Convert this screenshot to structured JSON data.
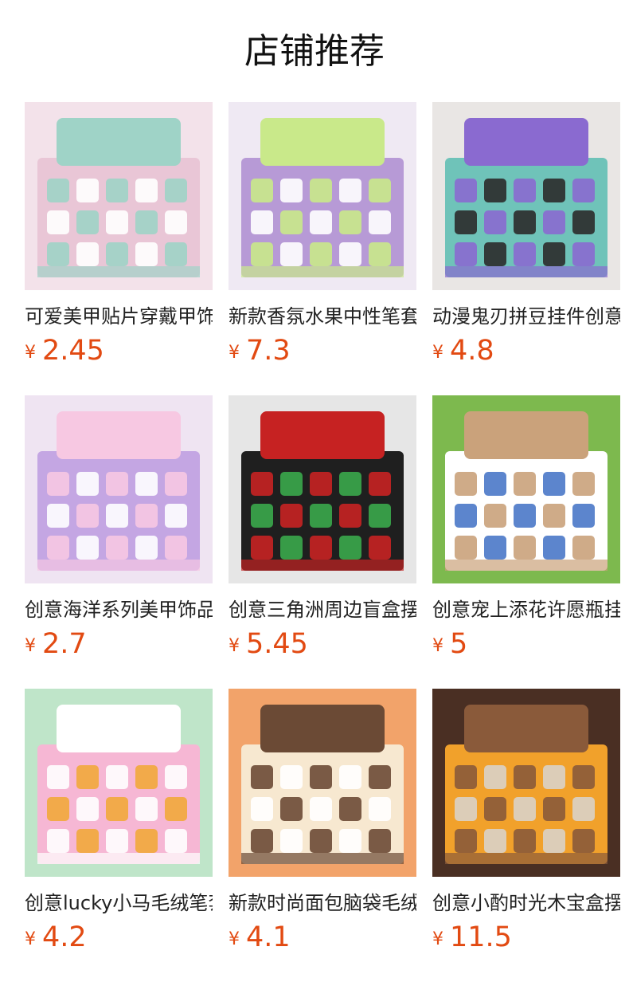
{
  "header": {
    "title": "店铺推荐"
  },
  "currency_symbol": "¥",
  "products": [
    {
      "name": "可爱美甲贴片穿戴甲饰品",
      "price": "2.45",
      "image": "nail-art-box-image",
      "palette": [
        "#f3e2ea",
        "#e9c6d6",
        "#9fd3c7",
        "#ffffff"
      ]
    },
    {
      "name": "新款香氛水果中性笔套装",
      "price": "7.3",
      "image": "fruit-gel-pen-display-image",
      "palette": [
        "#efe9f3",
        "#b79ad6",
        "#c9e98a",
        "#ffffff"
      ]
    },
    {
      "name": "动漫鬼刃拼豆挂件创意玩具",
      "price": "4.8",
      "image": "anime-bead-keychain-box-image",
      "palette": [
        "#e9e6e4",
        "#6fc3b9",
        "#8a6ad0",
        "#2b2b2b"
      ]
    },
    {
      "name": "创意海洋系列美甲饰品盒",
      "price": "2.7",
      "image": "ocean-nail-charm-box-image",
      "palette": [
        "#efe4f2",
        "#c4a6e3",
        "#f7c8e2",
        "#ffffff"
      ]
    },
    {
      "name": "创意三角洲周边盲盒摆件",
      "price": "5.45",
      "image": "delta-blind-box-display-image",
      "palette": [
        "#e6e6e6",
        "#1f1f1f",
        "#c62222",
        "#3aa84b"
      ]
    },
    {
      "name": "创意宠上添花许愿瓶挂件",
      "price": "5",
      "image": "pet-wish-bottle-shelf-image",
      "palette": [
        "#7db94e",
        "#ffffff",
        "#caa27b",
        "#4a78c8"
      ]
    },
    {
      "name": "创意lucky小马毛绒笔套装",
      "price": "4.2",
      "image": "lucky-pony-plush-pen-image",
      "palette": [
        "#bfe5c9",
        "#f6b7d4",
        "#ffffff",
        "#f2a93b"
      ]
    },
    {
      "name": "新款时尚面包脑袋毛绒笔",
      "price": "4.1",
      "image": "bread-head-plush-pen-image",
      "palette": [
        "#f2a36a",
        "#f7e8d0",
        "#6b4a35",
        "#ffffff"
      ]
    },
    {
      "name": "创意小酌时光木宝盒摆件",
      "price": "11.5",
      "image": "wooden-treasure-box-image",
      "palette": [
        "#4a2f23",
        "#f1a12b",
        "#8a5a3a",
        "#d9d2c8"
      ]
    }
  ]
}
